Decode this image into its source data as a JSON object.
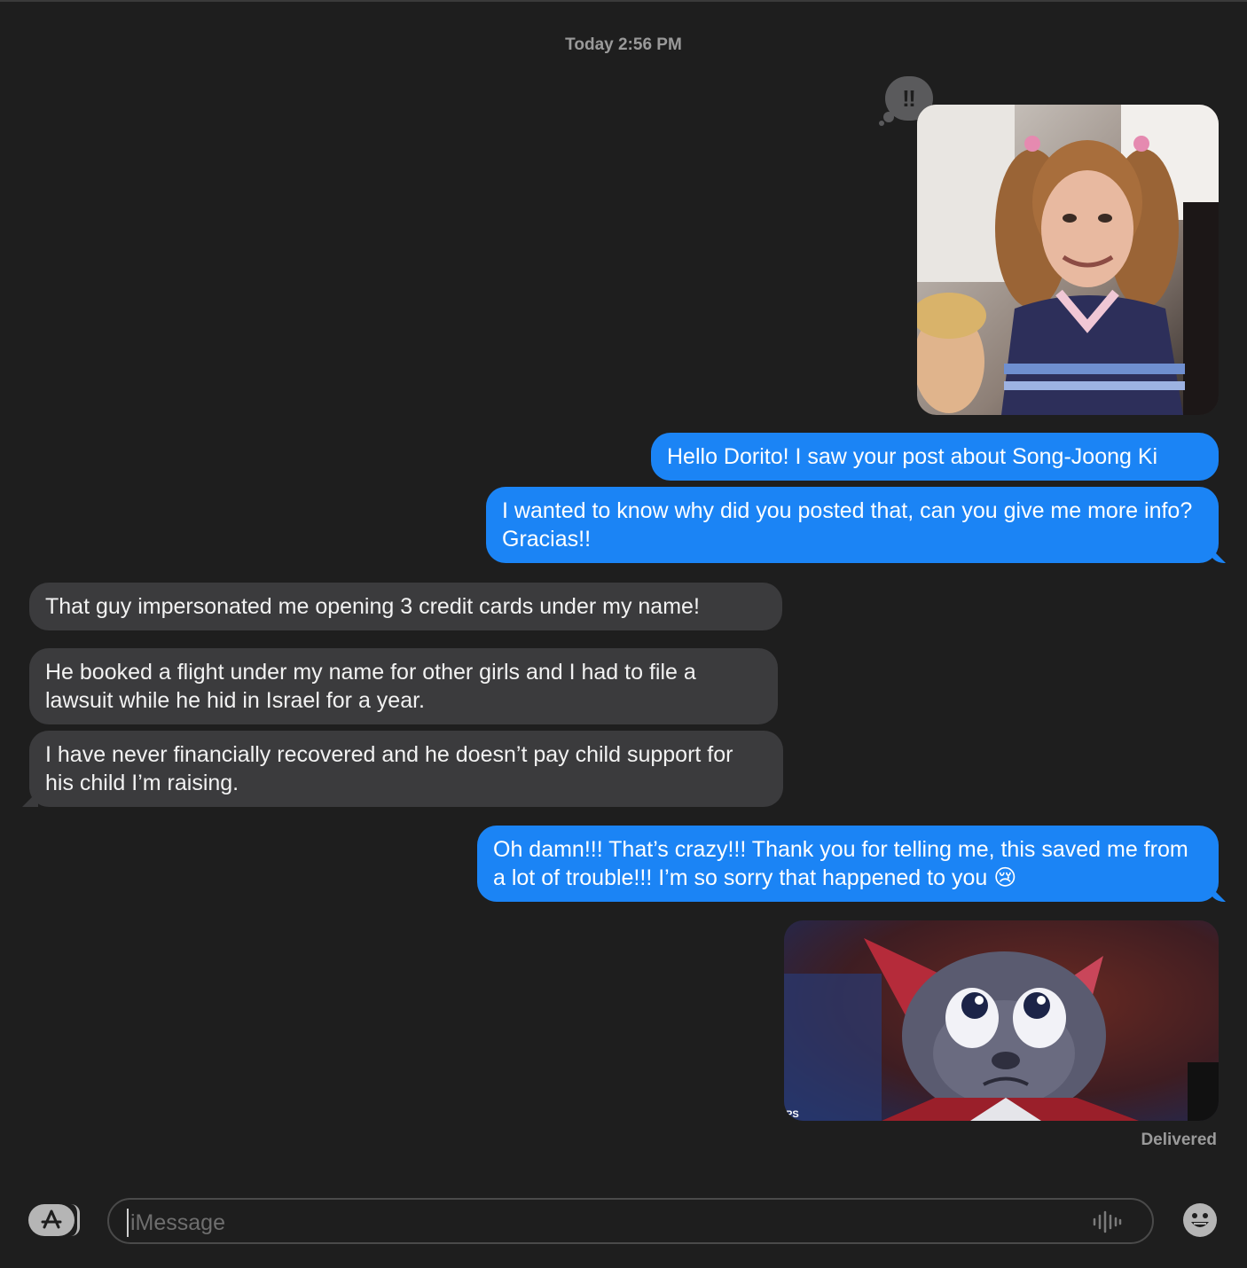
{
  "header": {
    "timestamp": "Today 2:56 PM"
  },
  "tapback": {
    "symbol": "‼",
    "icon": "exclamation-tapback-icon"
  },
  "messages": [
    {
      "direction": "outgoing",
      "text": "Hello Dorito! I saw your post about Song-Joong Ki"
    },
    {
      "direction": "outgoing",
      "text": "I wanted to know why did you posted that, can you give me more info? Gracias!!"
    },
    {
      "direction": "incoming",
      "text": "That guy impersonated me opening 3 credit cards under my name!"
    },
    {
      "direction": "incoming",
      "text": "He booked a flight under my name for other girls and I had to file a lawsuit while he hid in Israel for a year."
    },
    {
      "direction": "incoming",
      "text": "I have never financially recovered and he doesn’t pay child support for his child I’m raising."
    },
    {
      "direction": "outgoing",
      "text": "Oh damn!!! That’s crazy!!! Thank you for telling me, this saved me from a lot of trouble!!! I’m so sorry that happened to you 😢"
    }
  ],
  "attachments": [
    {
      "type": "photo",
      "description_icon": "girl-pigtails-photo"
    },
    {
      "type": "photo",
      "description_icon": "sad-bat-photo",
      "watermark": "PS"
    }
  ],
  "status": {
    "delivered": "Delivered"
  },
  "composer": {
    "placeholder": "iMessage",
    "apps_icon": "app-store-icon",
    "audio_icon": "waveform-icon",
    "emoji_icon": "emoji-icon"
  },
  "colors": {
    "background": "#1e1e1e",
    "outgoing_bubble": "#1b84f5",
    "incoming_bubble": "#3b3b3d",
    "meta_text": "#9a9a9a"
  }
}
